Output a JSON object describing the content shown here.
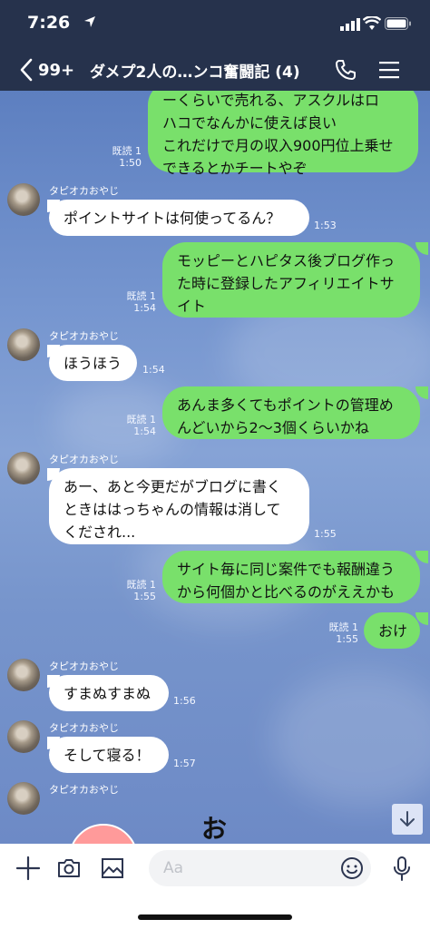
{
  "status_bar": {
    "time": "7:26"
  },
  "header": {
    "back_count": "99+",
    "title": "ダメプ2人の…ンコ奮闘記 (4)"
  },
  "sender_name": "タピオカおやじ",
  "messages": [
    {
      "side": "right",
      "lines": [
        "ーくらいで売れる、アスクルはロ",
        "ハコでなんかに使えば良い",
        "これだけで月の収入900円位上乗せ",
        "できるとかチートやぞ"
      ],
      "read": "既読 1",
      "time": "1:50"
    },
    {
      "side": "left",
      "lines": [
        "ポイントサイトは何使ってるん？"
      ],
      "time": "1:53"
    },
    {
      "side": "right",
      "lines": [
        "モッピーとハピタス後ブログ作っ",
        "た時に登録したアフィリエイトサ",
        "イト"
      ],
      "read": "既読 1",
      "time": "1:54"
    },
    {
      "side": "left",
      "lines": [
        "ほうほう"
      ],
      "time": "1:54"
    },
    {
      "side": "right",
      "lines": [
        "あんま多くてもポイントの管理め",
        "んどいから2〜3個くらいかね"
      ],
      "read": "既読 1",
      "time": "1:54"
    },
    {
      "side": "left",
      "lines": [
        "あー、あと今更だがブログに書く",
        "ときははっちゃんの情報は消して",
        "くだされ..."
      ],
      "time": "1:55"
    },
    {
      "side": "right",
      "lines": [
        "サイト毎に同じ案件でも報酬違う",
        "から何個かと比べるのがええかも"
      ],
      "read": "既読 1",
      "time": "1:55"
    },
    {
      "side": "right",
      "lines": [
        "おけ"
      ],
      "read": "既読 1",
      "time": "1:55"
    },
    {
      "side": "left",
      "lines": [
        "すまぬすまぬ"
      ],
      "time": "1:56"
    },
    {
      "side": "left",
      "lines": [
        "そして寝る！"
      ],
      "time": "1:57"
    }
  ],
  "sticker": {
    "char": "お"
  },
  "input": {
    "placeholder": "Aa"
  },
  "icons": {
    "plus": "plus-icon",
    "camera": "camera-icon",
    "image": "image-icon",
    "emoji": "emoji-icon",
    "mic": "mic-icon",
    "call": "phone-icon",
    "menu": "menu-icon",
    "scroll": "arrow-down-icon"
  },
  "colors": {
    "header_bg": "#26324c",
    "bubble_green": "#79e06b",
    "bubble_white": "#ffffff",
    "chat_bg": "#7595cf"
  }
}
